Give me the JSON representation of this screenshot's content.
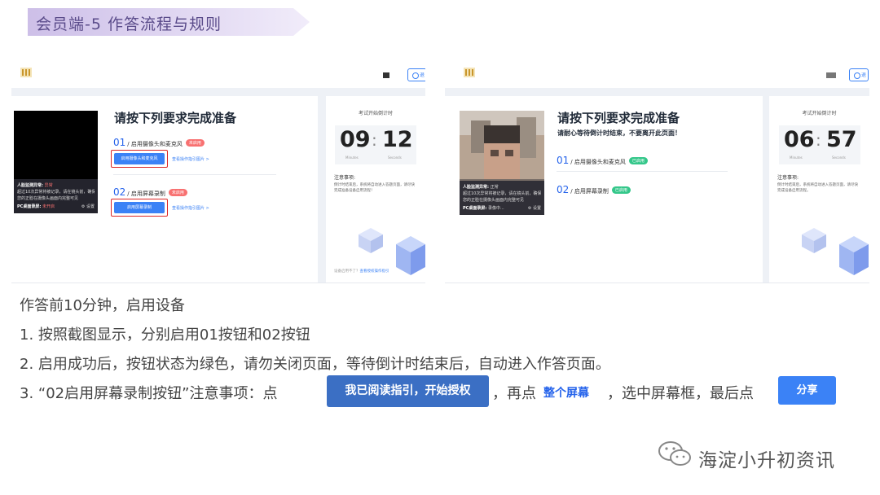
{
  "banner": {
    "title": "会员端-5  作答流程与规则",
    "color": "#d9cfee"
  },
  "screen_left": {
    "top_button_label": "退",
    "camera_info": {
      "face_label": "人脸监测异常:",
      "face_status": "异常",
      "desc1": "超过10次异常将被记录，请在镜头前，确保",
      "desc2": "您的正脸在摄像头画面内完整可见",
      "screen_label": "PC桌面录屏:",
      "screen_status": "未开启",
      "settings": "设置"
    },
    "title": "请按下列要求完成准备",
    "step1": {
      "num": "01",
      "label": "/ 启用摄像头和麦克风",
      "tag": "未启用",
      "button": "启用摄像头和麦克风",
      "guide": "查看操作指引图片 >"
    },
    "step2": {
      "num": "02",
      "label": "/ 启用屏幕录制",
      "tag": "未启用",
      "button": "启用屏幕录制",
      "guide": "查看操作指引图片 >"
    },
    "countdown": {
      "title": "考试开始倒计时",
      "minutes": "09",
      "seconds": "12",
      "min_unit": "Minutes",
      "sec_unit": "Seconds"
    },
    "notes": {
      "title": "注意事项:",
      "body": "倒计时结束后，系统将自动进入答题页面，请尽快完成准备设备启用流程！"
    },
    "help": {
      "question": "设备启用不了？",
      "link": "查看授权操作指引"
    }
  },
  "screen_right": {
    "top_button_label": "退",
    "camera_info": {
      "face_label": "人脸监测异常:",
      "face_status": "正常",
      "desc1": "超过10次异常将被记录，请在镜头前，确保",
      "desc2": "您的正脸在摄像头画面内完整可见",
      "screen_label": "PC桌面录屏:",
      "screen_status": "录像中...",
      "settings": "设置"
    },
    "title": "请按下列要求完成准备",
    "subtitle": "请耐心等待倒计时结束，不要离开此页面！",
    "step1": {
      "num": "01",
      "label": "/ 启用摄像头和麦克风",
      "tag": "已启用"
    },
    "step2": {
      "num": "02",
      "label": "/ 启用屏幕录制",
      "tag": "已启用"
    },
    "countdown": {
      "title": "考试开始倒计时",
      "minutes": "06",
      "seconds": "57",
      "min_unit": "Minutes",
      "sec_unit": "Seconds"
    },
    "notes": {
      "title": "注意事项:",
      "body": "倒计时结束后，系统将自动进入答题页面，请尽快完成设备启用流程。"
    }
  },
  "instructions": {
    "intro": "作答前10分钟，启用设备",
    "line1": "1. 按照截图显示，分别启用01按钮和02按钮",
    "line2": "2. 启用成功后，按钮状态为绿色，请勿关闭页面，等待倒计时结束后，自动进入作答页面。",
    "line3_prefix": "3. “02启用屏幕录制按钮”注意事项：点",
    "auth_button": "我已阅读指引，开始授权",
    "line3_mid": "，再点",
    "full_screen": "整个屏幕",
    "line3_mid2": "，选中屏幕框，最后点",
    "share_button": "分享"
  },
  "watermark": {
    "text": "海淀小升初资讯"
  }
}
